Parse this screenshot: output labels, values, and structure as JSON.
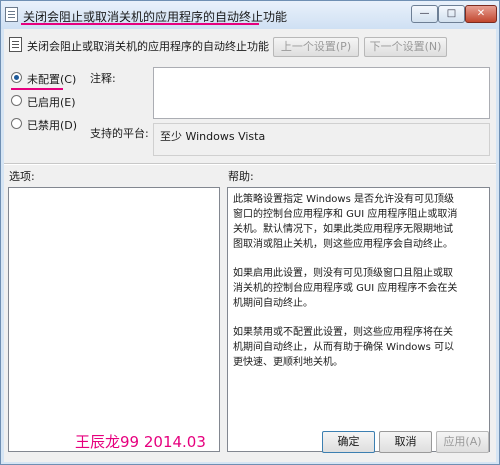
{
  "window": {
    "title": "关闭会阻止或取消关机的应用程序的自动终止功能",
    "accent_color": "#e6007e",
    "controls": {
      "minimize": "—",
      "maximize": "□",
      "close": "✕"
    }
  },
  "setting": {
    "name": "关闭会阻止或取消关机的应用程序的自动终止功能",
    "prev_label": "上一个设置(P)",
    "next_label": "下一个设置(N)"
  },
  "state": {
    "options": [
      {
        "label": "未配置(C)",
        "checked": true
      },
      {
        "label": "已启用(E)",
        "checked": false
      },
      {
        "label": "已禁用(D)",
        "checked": false
      }
    ]
  },
  "comment": {
    "label": "注释:",
    "value": ""
  },
  "platform": {
    "label": "支持的平台:",
    "value": "至少 Windows Vista"
  },
  "options_panel": {
    "label": "选项:"
  },
  "help_panel": {
    "label": "帮助:",
    "paragraphs": [
      "此策略设置指定 Windows 是否允许没有可见顶级\n窗口的控制台应用程序和 GUI 应用程序阻止或取消\n关机。默认情况下，如果此类应用程序无限期地试\n图取消或阻止关机，则这些应用程序会自动终止。",
      "如果启用此设置，则没有可见顶级窗口且阻止或取\n消关机的控制台应用程序或 GUI 应用程序不会在关\n机期间自动终止。",
      "如果禁用或不配置此设置，则这些应用程序将在关\n机期间自动终止，从而有助于确保 Windows 可以\n更快速、更顺利地关机。"
    ]
  },
  "buttons": {
    "ok": "确定",
    "cancel": "取消",
    "apply": "应用(A)"
  },
  "watermark": "王辰龙99 2014.03"
}
